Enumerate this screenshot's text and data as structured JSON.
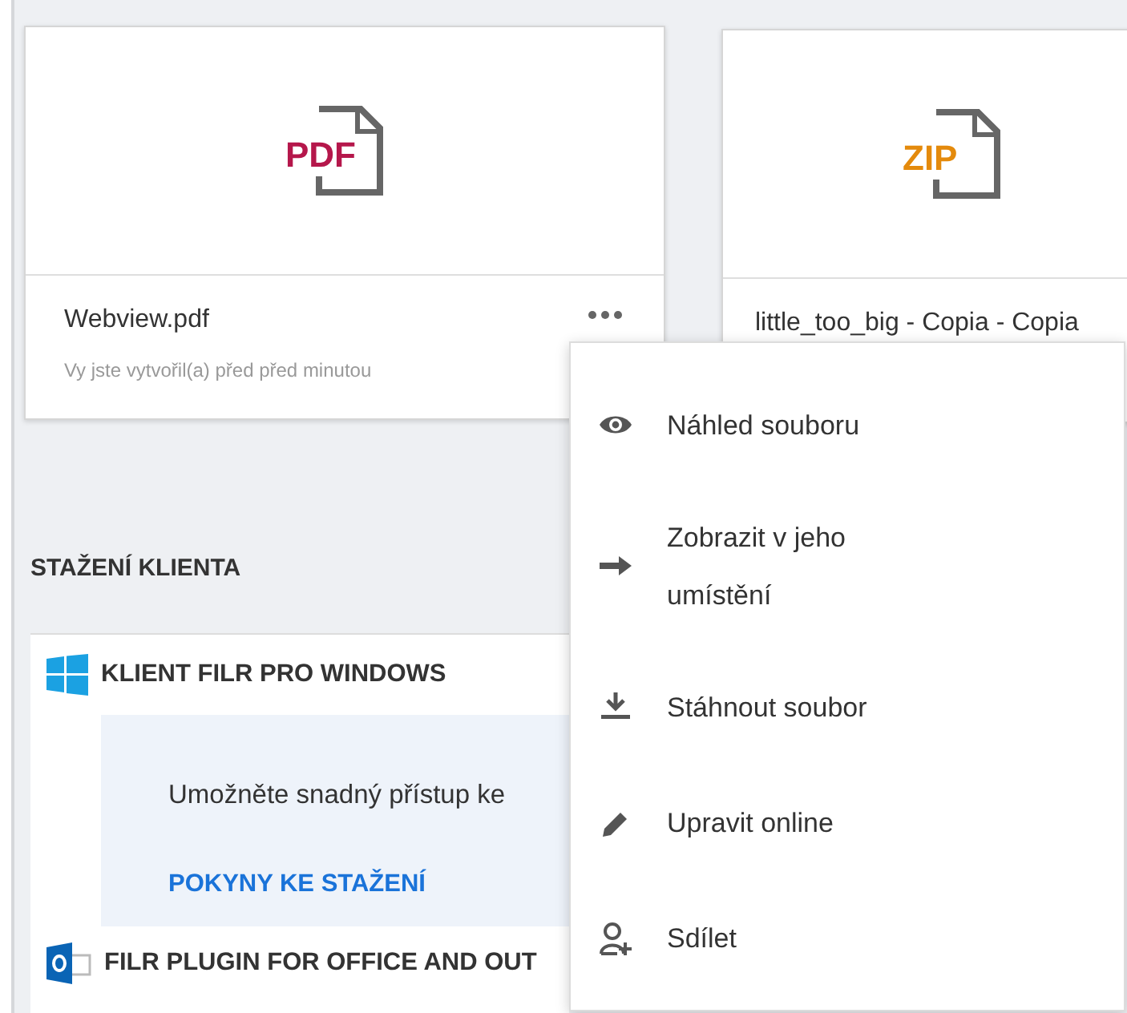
{
  "files": [
    {
      "name": "Webview.pdf",
      "kind": "pdf",
      "badge": "PDF",
      "subtitle": "Vy jste vytvořil(a) před před minutou",
      "has_menu": true
    },
    {
      "name": "little_too_big - Copia - Copia",
      "kind": "zip",
      "badge": "ZIP",
      "has_menu": false
    }
  ],
  "client_downloads": {
    "heading": "STAŽENÍ KLIENTA",
    "clients": [
      {
        "kind": "windows",
        "title": "KLIENT FILR PRO WINDOWS",
        "description": "Umožněte snadný přístup ke",
        "link": "POKYNY KE STAŽENÍ"
      },
      {
        "kind": "outlook",
        "title": "FILR PLUGIN FOR OFFICE AND OUT"
      }
    ]
  },
  "context_menu": {
    "items": [
      {
        "kind": "eye",
        "label": "Náhled souboru"
      },
      {
        "kind": "arrow",
        "label": "Zobrazit v jeho umístění"
      },
      {
        "kind": "download",
        "label": "Stáhnout soubor"
      },
      {
        "kind": "pencil",
        "label": "Upravit online"
      },
      {
        "kind": "share",
        "label": "Sdílet"
      }
    ]
  }
}
